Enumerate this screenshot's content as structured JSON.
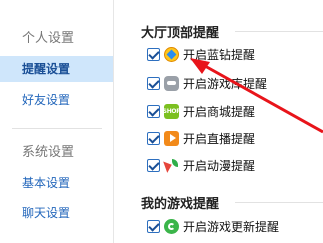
{
  "sidebar": {
    "groups": [
      {
        "title": "个人设置",
        "items": [
          {
            "label": "提醒设置",
            "active": true
          },
          {
            "label": "好友设置",
            "active": false
          }
        ]
      },
      {
        "title": "系统设置",
        "items": [
          {
            "label": "基本设置",
            "active": false
          },
          {
            "label": "聊天设置",
            "active": false
          }
        ]
      }
    ]
  },
  "main": {
    "sections": [
      {
        "title": "大厅顶部提醒",
        "options": [
          {
            "label": "开启蓝钻提醒",
            "checked": true,
            "icon": "blue-diamond-icon"
          },
          {
            "label": "开启游戏库提醒",
            "checked": true,
            "icon": "gamepad-icon"
          },
          {
            "label": "开启商城提醒",
            "checked": true,
            "icon": "shop-icon",
            "icon_text": "SHOP"
          },
          {
            "label": "开启直播提醒",
            "checked": true,
            "icon": "live-play-icon"
          },
          {
            "label": "开启动漫提醒",
            "checked": true,
            "icon": "anime-icon"
          }
        ]
      },
      {
        "title": "我的游戏提醒",
        "options": [
          {
            "label": "开启游戏更新提醒",
            "checked": true,
            "icon": "update-icon"
          }
        ]
      }
    ]
  },
  "colors": {
    "active_bg": "#cfe6fb",
    "link": "#2266bb",
    "checkbox": "#2d6fbf",
    "annotation_arrow": "#e8141a"
  }
}
